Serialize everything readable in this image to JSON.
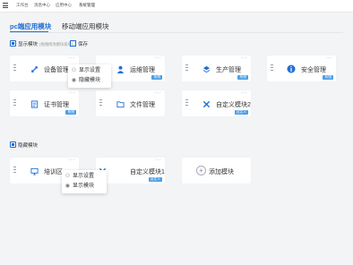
{
  "topbar": {
    "nav": [
      "工作台",
      "消息中心",
      "应用中心",
      "系统管理"
    ]
  },
  "tabs": [
    {
      "label": "pc端应用模块"
    },
    {
      "label": "移动端应用模块"
    }
  ],
  "display_section": {
    "title": "显示模块",
    "hint": "(拖拽修改模块排序)",
    "save_label": "保存"
  },
  "display_cards": [
    {
      "label": "设备管理",
      "icon": "wrench-icon"
    },
    {
      "label": "运维管理",
      "icon": "user-icon",
      "badge": "系统"
    },
    {
      "label": "生产管理",
      "icon": "layers-icon",
      "badge": "系统"
    },
    {
      "label": "安全管理",
      "icon": "info-icon",
      "badge": "系统"
    },
    {
      "label": "证书管理",
      "icon": "certificate-icon",
      "badge": "系统"
    },
    {
      "label": "文件管理",
      "icon": "folder-icon"
    },
    {
      "label": "自定义模块2",
      "icon": "tools-icon",
      "badge": "自定义"
    }
  ],
  "popup_top": {
    "items": [
      "显示设置",
      "隐藏模块"
    ]
  },
  "hidden_section": {
    "title": "隐藏模块"
  },
  "hidden_cards": [
    {
      "label": "培训区",
      "icon": "monitor-icon"
    },
    {
      "label": "自定义模块1",
      "icon": "tools-icon",
      "badge": "自定义"
    }
  ],
  "add_card": {
    "label": "添加模块"
  },
  "popup_bottom": {
    "items": [
      "显示设置",
      "显示模块"
    ]
  }
}
